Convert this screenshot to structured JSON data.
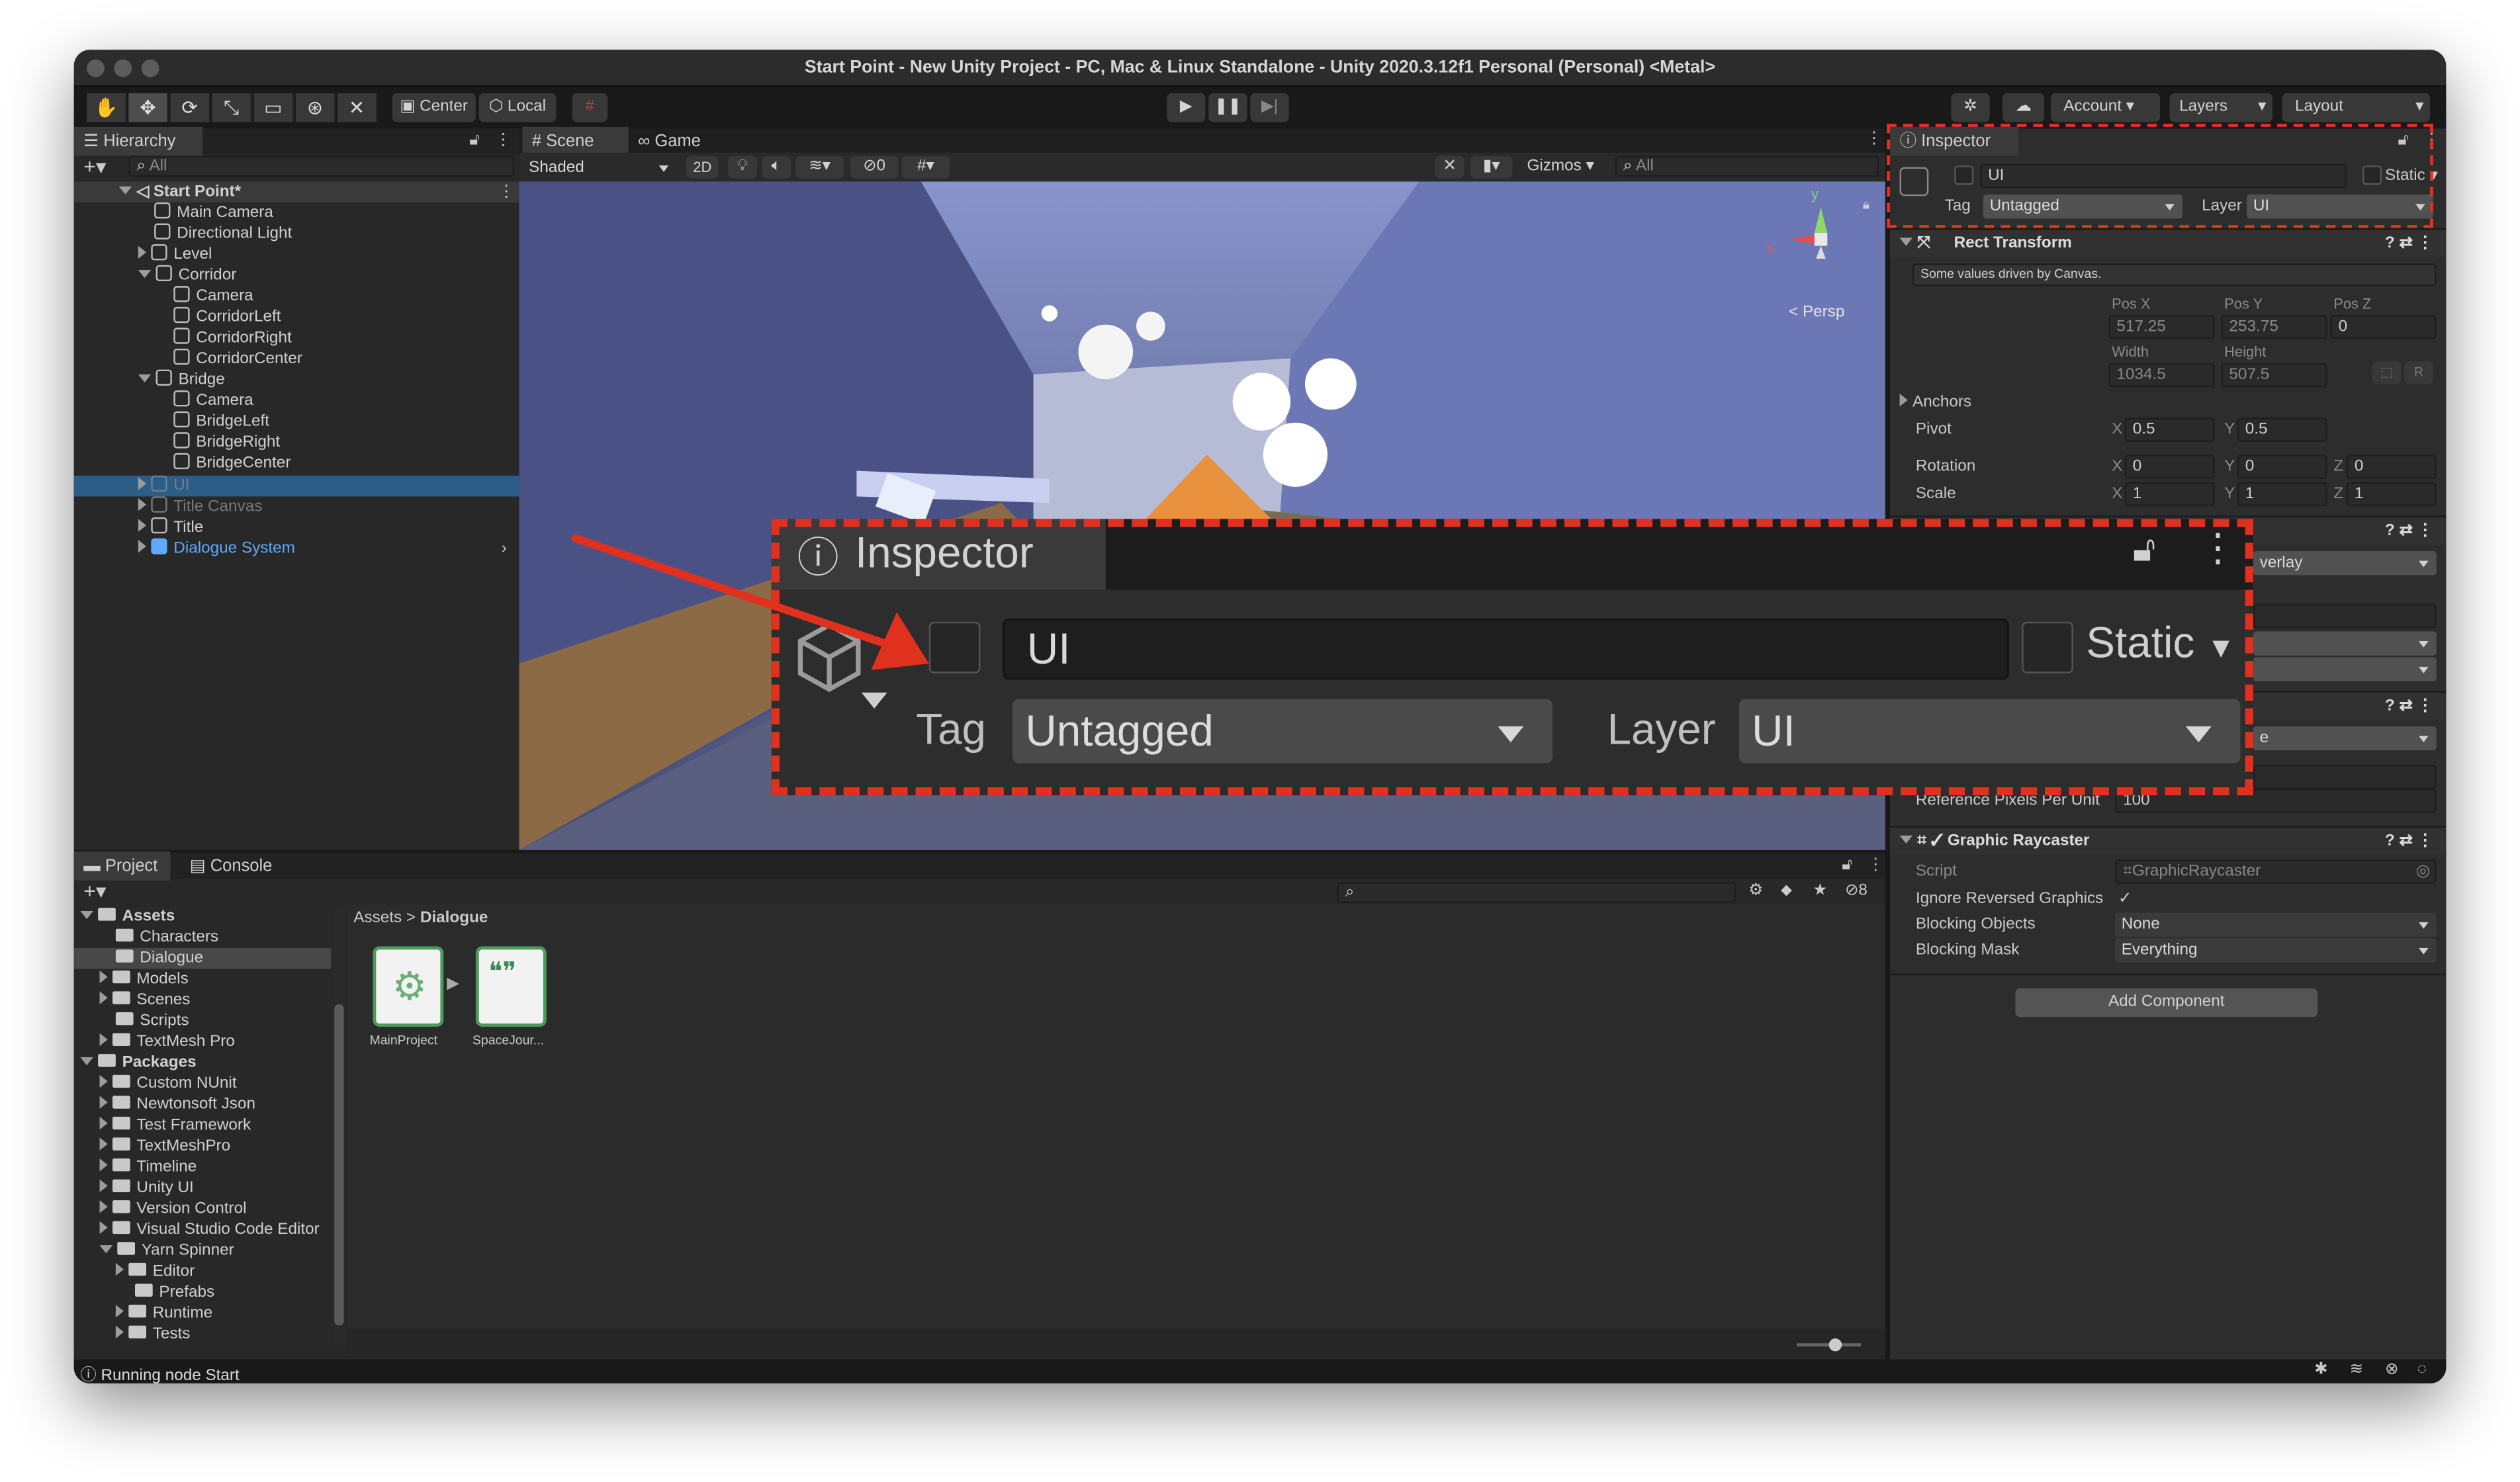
{
  "window": {
    "title": "Start Point - New Unity Project - PC, Mac & Linux Standalone - Unity 2020.3.12f1 Personal (Personal) <Metal>"
  },
  "toolbar": {
    "center_label": "Center",
    "local_label": "Local",
    "account_label": "Account",
    "layers_label": "Layers",
    "layout_label": "Layout"
  },
  "hierarchy": {
    "tab": "Hierarchy",
    "search_placeholder": "All",
    "scene": "Start Point*",
    "items": [
      {
        "label": "Main Camera"
      },
      {
        "label": "Directional Light"
      },
      {
        "label": "Level"
      },
      {
        "label": "Corridor"
      },
      {
        "label": "Camera"
      },
      {
        "label": "CorridorLeft"
      },
      {
        "label": "CorridorRight"
      },
      {
        "label": "CorridorCenter"
      },
      {
        "label": "Bridge"
      },
      {
        "label": "Camera"
      },
      {
        "label": "BridgeLeft"
      },
      {
        "label": "BridgeRight"
      },
      {
        "label": "BridgeCenter"
      },
      {
        "label": "UI"
      },
      {
        "label": "Title Canvas"
      },
      {
        "label": "Title"
      },
      {
        "label": "Dialogue System"
      }
    ]
  },
  "scene": {
    "tab_scene": "Scene",
    "tab_game": "Game",
    "shading": "Shaded",
    "mode_2d": "2D",
    "hidden_count": "0",
    "gizmos": "Gizmos",
    "search_placeholder": "All",
    "axis_y": "y",
    "axis_x": "x",
    "persp": "Persp"
  },
  "project": {
    "tab_project": "Project",
    "tab_console": "Console",
    "visible_count": "8",
    "tree": [
      {
        "label": "Assets"
      },
      {
        "label": "Characters"
      },
      {
        "label": "Dialogue"
      },
      {
        "label": "Models"
      },
      {
        "label": "Scenes"
      },
      {
        "label": "Scripts"
      },
      {
        "label": "TextMesh Pro"
      },
      {
        "label": "Packages"
      },
      {
        "label": "Custom NUnit"
      },
      {
        "label": "Newtonsoft Json"
      },
      {
        "label": "Test Framework"
      },
      {
        "label": "TextMeshPro"
      },
      {
        "label": "Timeline"
      },
      {
        "label": "Unity UI"
      },
      {
        "label": "Version Control"
      },
      {
        "label": "Visual Studio Code Editor"
      },
      {
        "label": "Yarn Spinner"
      },
      {
        "label": "Editor"
      },
      {
        "label": "Prefabs"
      },
      {
        "label": "Runtime"
      },
      {
        "label": "Tests"
      }
    ],
    "breadcrumb_root": "Assets",
    "breadcrumb_sep": ">",
    "breadcrumb_current": "Dialogue",
    "assets": [
      {
        "label": "MainProject"
      },
      {
        "label": "SpaceJour..."
      }
    ]
  },
  "inspector": {
    "tab": "Inspector",
    "object_name": "UI",
    "static_label": "Static",
    "tag_label": "Tag",
    "tag_value": "Untagged",
    "layer_label": "Layer",
    "layer_value": "UI",
    "rect_transform": {
      "title": "Rect Transform",
      "note": "Some values driven by Canvas.",
      "posx_label": "Pos X",
      "posy_label": "Pos Y",
      "posz_label": "Pos Z",
      "posx": "517.25",
      "posy": "253.75",
      "posz": "0",
      "width_label": "Width",
      "height_label": "Height",
      "width": "1034.5",
      "height": "507.5",
      "r_button": "R",
      "anchors_label": "Anchors",
      "pivot_label": "Pivot",
      "pivot_x": "0.5",
      "pivot_y": "0.5",
      "rotation_label": "Rotation",
      "rot_x": "0",
      "rot_y": "0",
      "rot_z": "0",
      "scale_label": "Scale",
      "scale_x": "1",
      "scale_y": "1",
      "scale_z": "1",
      "x": "X",
      "y": "Y",
      "z": "Z"
    },
    "canvas_render_mode": "verlay",
    "scaler_partial": "e",
    "ref_pixels_label": "Reference Pixels Per Unit",
    "ref_pixels_value": "100",
    "graphic_raycaster": {
      "title": "Graphic Raycaster",
      "script_label": "Script",
      "script_value": "GraphicRaycaster",
      "ignore_label": "Ignore Reversed Graphics",
      "check": "✓",
      "blocking_objects_label": "Blocking Objects",
      "blocking_objects_value": "None",
      "blocking_mask_label": "Blocking Mask",
      "blocking_mask_value": "Everything"
    },
    "add_component": "Add Component"
  },
  "status": {
    "text": "Running node Start"
  },
  "zoom": {
    "tab": "Inspector",
    "object_name": "UI",
    "static_label": "Static",
    "tag_label": "Tag",
    "tag_value": "Untagged",
    "layer_label": "Layer",
    "layer_value": "UI"
  },
  "colors": {
    "highlight": "#e0301e",
    "selection": "#2c5d87",
    "prefab_blue": "#5fa9ff"
  }
}
